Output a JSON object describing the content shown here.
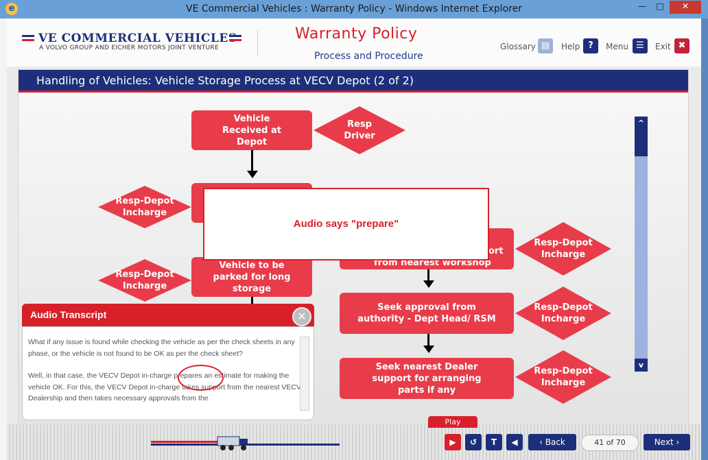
{
  "window": {
    "title": "VE Commercial Vehicles : Warranty Policy - Windows Internet Explorer",
    "browser_icon": "ie-icon",
    "min_label": "—",
    "max_label": "□",
    "close_label": "✕"
  },
  "header": {
    "logo_text": "VE COMMERCIAL VEHICLES",
    "logo_sub": "A VOLVO GROUP AND EICHER MOTORS JOINT VENTURE",
    "title": "Warranty Policy",
    "subtitle": "Process and Procedure",
    "buttons": {
      "glossary": "Glossary",
      "help": "Help",
      "menu": "Menu",
      "exit": "Exit"
    },
    "colors": {
      "brand_blue": "#1d2f7a",
      "brand_red": "#d7202a"
    }
  },
  "panel": {
    "title": "Handling of Vehicles: Vehicle Storage Process at VECV Depot (2 of 2)"
  },
  "flow": {
    "box1": "Vehicle Received at Depot",
    "diamond1": "Resp Driver",
    "diamond2": "Resp-Depot Incharge",
    "box3": "Vehicle to be parked for long storage",
    "diamond3": "Resp-Depot Incharge",
    "box4_fragment": "ort",
    "box4_line2": "from nearest workshop",
    "diamond4": "Resp-Depot Incharge",
    "box5": "Seek approval from authority - Dept Head/ RSM",
    "diamond5": "Resp-Depot Incharge",
    "box6": "Seek nearest Dealer support for arranging parts if any",
    "diamond6": "Resp-Depot Incharge"
  },
  "scroll": {
    "up": "^",
    "down": "v"
  },
  "popup": {
    "text": "Audio says \"prepare\""
  },
  "transcript": {
    "title": "Audio Transcript",
    "close": "✕",
    "para1": "What if any issue is found while checking the vehicle as per the check sheets in any phase, or the vehicle is not found to be OK as per the check sheet?",
    "para2": "Well, in that case, the VECV Depot in-charge prepares an estimate for making the vehicle OK. For this, the VECV Depot in-charge takes support from the nearest VECV Dealership and then takes necessary approvals from the"
  },
  "footer": {
    "play_label": "Play",
    "back": "Back",
    "page": "41 of 70",
    "next": "Next",
    "controls": [
      "play-icon",
      "replay-icon",
      "text-icon",
      "audio-icon"
    ]
  }
}
